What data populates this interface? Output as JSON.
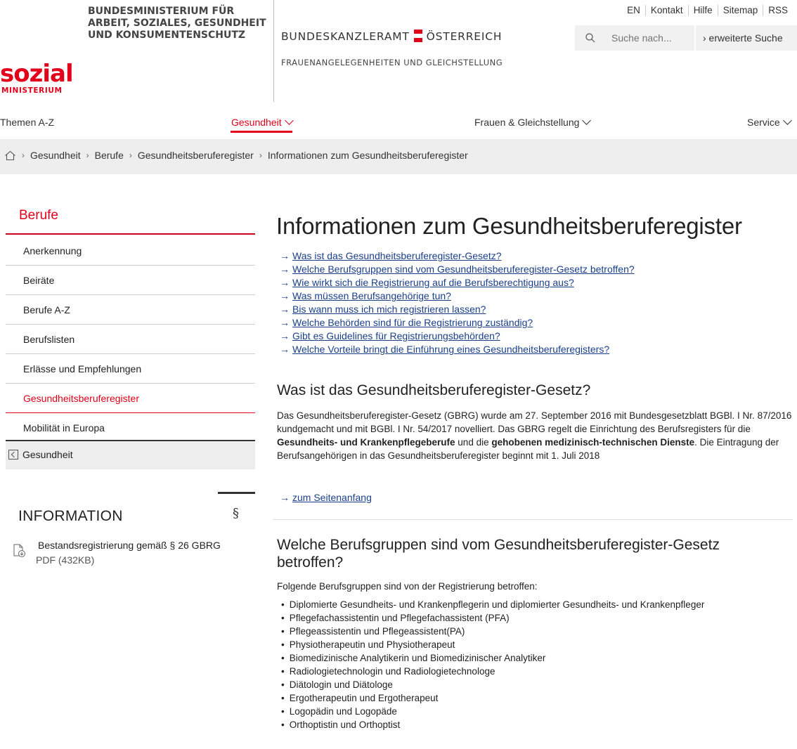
{
  "header": {
    "logo_word": "sozial",
    "logo_sub": "MINISTERIUM",
    "ministry_name": "BUNDESMINISTERIUM FÜR\nARBEIT, SOZIALES, GESUNDHEIT\nUND KONSUMENTENSCHUTZ",
    "bka_left": "BUNDESKANZLERAMT",
    "bka_right": "ÖSTERREICH",
    "frauen": "FRAUENANGELEGENHEITEN UND GLEICHSTELLUNG",
    "toplinks": [
      "EN",
      "Kontakt",
      "Hilfe",
      "Sitemap",
      "RSS"
    ],
    "search_placeholder": "Suche nach...",
    "advanced_search": "› erweiterte Suche"
  },
  "nav": {
    "items": [
      {
        "label": "Themen A-Z"
      },
      {
        "label": "Gesundheit"
      },
      {
        "label": "Frauen & Gleichstellung"
      },
      {
        "label": "Service"
      }
    ]
  },
  "breadcrumb": [
    "Gesundheit",
    "Berufe",
    "Gesundheitsberuferegister",
    "Informationen zum Gesundheitsberuferegister"
  ],
  "sidebar": {
    "title": "Berufe",
    "items": [
      {
        "label": "Anerkennung"
      },
      {
        "label": "Beiräte"
      },
      {
        "label": "Berufe A-Z"
      },
      {
        "label": "Berufslisten"
      },
      {
        "label": "Erlässe und Empfehlungen"
      },
      {
        "label": "Gesundheitsberuferegister"
      },
      {
        "label": "Mobilität in Europa"
      }
    ],
    "back_label": "Gesundheit",
    "info_title": "INFORMATION",
    "info_symbol": "§",
    "doc_link": "Bestandsregistrierung gemäß § 26 GBRG",
    "doc_meta": "PDF (432KB)"
  },
  "content": {
    "title": "Informationen zum Gesundheitsberuferegister",
    "toc": [
      "Was ist das Gesundheitsberuferegister-Gesetz?",
      "Welche Berufsgruppen sind vom Gesundheitsberuferegister-Gesetz betroffen?",
      "Wie wirkt sich die Registrierung auf die Berufsberechtigung aus?",
      "Was müssen Berufsangehörige tun?",
      "Bis wann muss ich mich registrieren lassen?",
      "Welche Behörden sind für die Registrierung zuständig?",
      "Gibt es Guidelines für Registrierungsbehörden?",
      "Welche Vorteile bringt die Einführung eines Gesundheitsberuferegisters?"
    ],
    "section1_title": "Was ist das Gesundheitsberuferegister-Gesetz?",
    "section1_p1": "Das Gesundheitsberuferegister-Gesetz (GBRG) wurde am 27. September 2016 mit Bundesgesetzblatt BGBl. I Nr. 87/2016 kundgemacht und mit BGBl. I Nr. 54/2017 novelliert. Das GBRG regelt die Einrichtung des Berufsregisters für die ",
    "section1_b1": "Gesundheits- und Krankenpflegeberufe",
    "section1_p2": " und die ",
    "section1_b2": "gehobenen medizinisch-technischen Dienste",
    "section1_p3": ". Die Eintragung der Berufsangehörigen in das Gesundheitsberuferegister beginnt mit 1. Juli 2018",
    "to_top": "zum Seitenanfang",
    "section2_title": "Welche Berufsgruppen sind vom Gesundheitsberuferegister-Gesetz betroffen?",
    "section2_intro": "Folgende Berufsgruppen sind von der Registrierung betroffen:",
    "section2_list": [
      "Diplomierte Gesundheits- und Krankenpflegerin und diplomierter Gesundheits- und Krankenpfleger",
      "Pflegefachassistentin und Pflegefachassistent (PFA)",
      "Pflegeassistentin und Pflegeassistent(PA)",
      "Physiotherapeutin und Physiotherapeut",
      "Biomedizinische Analytikerin und Biomedizinischer Analytiker",
      "Radiologietechnologin und Radiologietechnologe",
      "Diätologin und Diätologe",
      "Ergotherapeutin und Ergotherapeut",
      "Logopädin und Logopäde",
      "Orthoptistin und Orthoptist"
    ]
  },
  "colors": {
    "brand_red": "#e2001a",
    "link_blue": "#1a3f8a",
    "breadcrumb_bg": "#eeeeee"
  }
}
